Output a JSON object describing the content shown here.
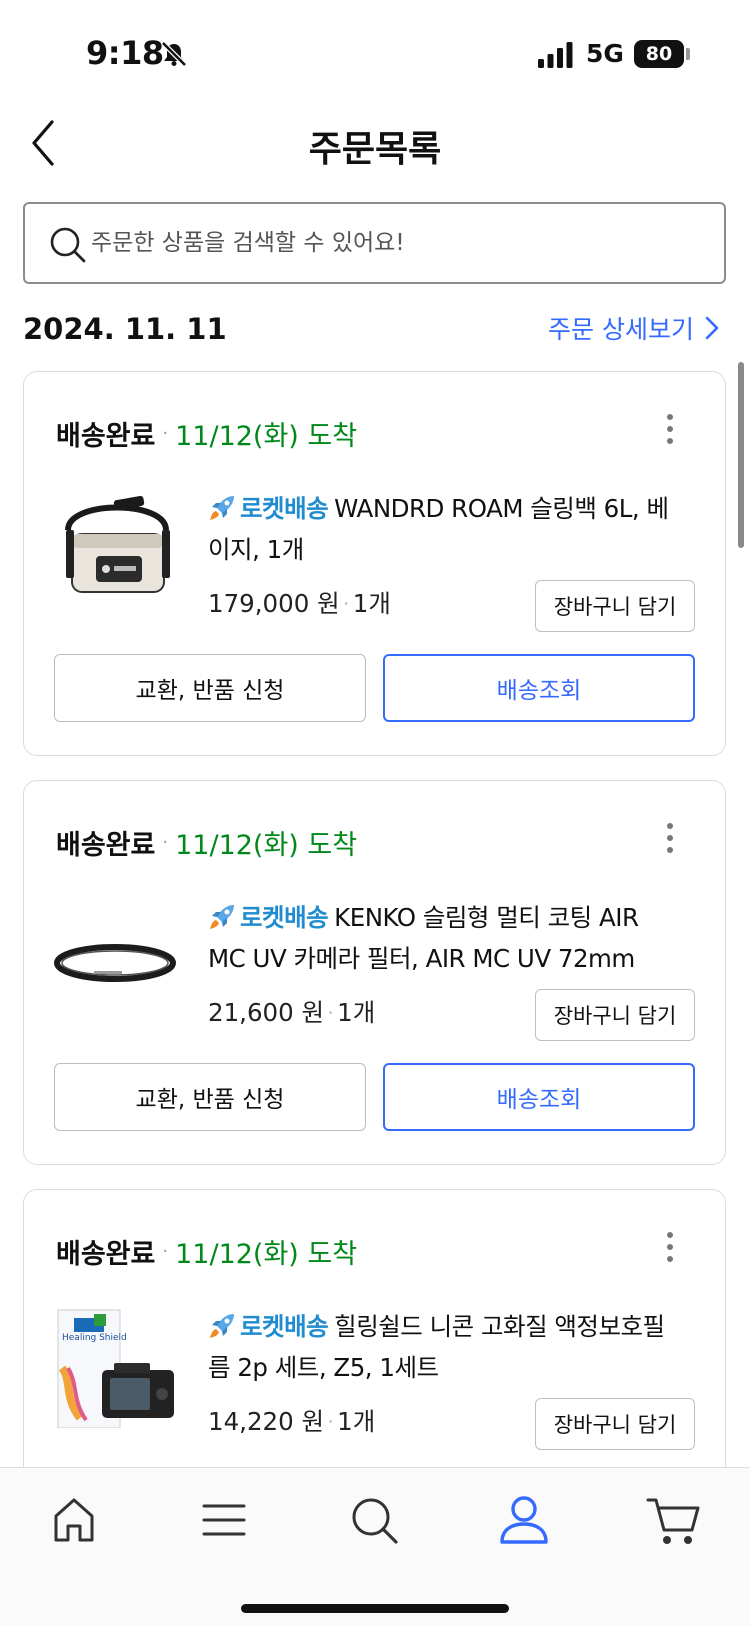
{
  "status_bar": {
    "time": "9:18",
    "network": "5G",
    "battery": "80"
  },
  "header": {
    "title": "주문목록"
  },
  "search": {
    "placeholder": "주문한 상품을 검색할 수 있어요!"
  },
  "order": {
    "date": "2024. 11. 11",
    "detail_link": "주문 상세보기"
  },
  "items": [
    {
      "status": "배송완료",
      "arrival": "11/12(화) 도착",
      "badge": "로켓배송",
      "name": "WANDRD ROAM 슬링백 6L, 베이지, 1개",
      "price": "179,000 원",
      "qty": "1개",
      "cart_button": "장바구니 담기",
      "return_button": "교환, 반품 신청",
      "track_button": "배송조회"
    },
    {
      "status": "배송완료",
      "arrival": "11/12(화) 도착",
      "badge": "로켓배송",
      "name": "KENKO 슬림형 멀티 코팅 AIR MC UV 카메라 필터, AIR MC UV 72mm",
      "price": "21,600 원",
      "qty": "1개",
      "cart_button": "장바구니 담기",
      "return_button": "교환, 반품 신청",
      "track_button": "배송조회"
    },
    {
      "status": "배송완료",
      "arrival": "11/12(화) 도착",
      "badge": "로켓배송",
      "name": "힐링쉴드 니콘 고화질 액정보호필름 2p 세트, Z5, 1세트",
      "price": "14,220 원",
      "qty": "1개",
      "cart_button": "장바구니 담기",
      "product_image_text": "Healing Shield"
    }
  ],
  "tab_bar": {
    "items": [
      "home-icon",
      "menu-icon",
      "search-icon",
      "my-account-icon",
      "cart-icon"
    ],
    "active": "my-account-icon"
  },
  "colors": {
    "accent": "#346aff",
    "arrival_green": "#00891a",
    "rocket_blue": "#1e8ccf"
  }
}
